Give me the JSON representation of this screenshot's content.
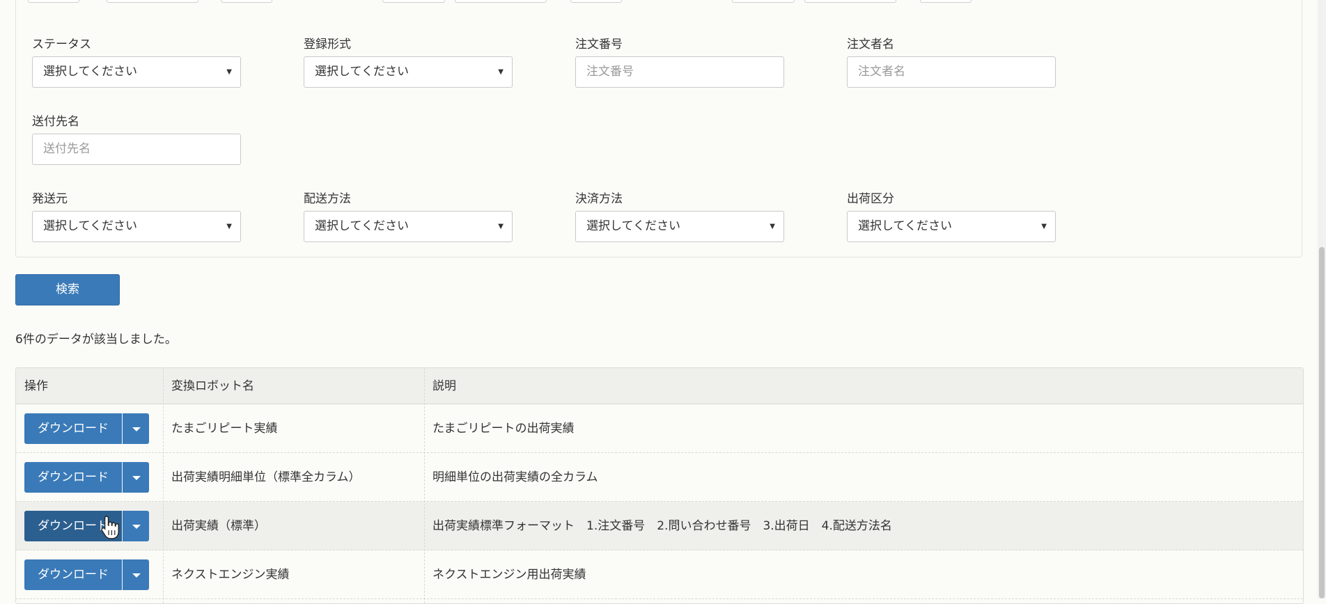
{
  "filters": {
    "status": {
      "label": "ステータス",
      "value": "選択してください"
    },
    "registration_type": {
      "label": "登録形式",
      "value": "選択してください"
    },
    "order_number": {
      "label": "注文番号",
      "placeholder": "注文番号"
    },
    "orderer_name": {
      "label": "注文者名",
      "placeholder": "注文者名"
    },
    "recipient_name": {
      "label": "送付先名",
      "placeholder": "送付先名"
    },
    "sender": {
      "label": "発送元",
      "value": "選択してください"
    },
    "delivery_method": {
      "label": "配送方法",
      "value": "選択してください"
    },
    "payment_method": {
      "label": "決済方法",
      "value": "選択してください"
    },
    "shipping_category": {
      "label": "出荷区分",
      "value": "選択してください"
    }
  },
  "search_button": "検索",
  "result_count_text": "6件のデータが該当しました。",
  "table": {
    "headers": [
      "操作",
      "変換ロボット名",
      "説明"
    ],
    "download_label": "ダウンロード",
    "rows": [
      {
        "name": "たまごリピート実績",
        "description": "たまごリピートの出荷実績"
      },
      {
        "name": "出荷実績明細単位（標準全カラム）",
        "description": "明細単位の出荷実績の全カラム"
      },
      {
        "name": "出荷実績（標準）",
        "description": "出荷実績標準フォーマット　1.注文番号　2.問い合わせ番号　3.出荷日　4.配送方法名"
      },
      {
        "name": "ネクストエンジン実績",
        "description": "ネクストエンジン用出荷実績"
      }
    ]
  },
  "icons": {
    "caret": "caret-down-icon",
    "cursor": "hand-pointer-icon"
  },
  "colors": {
    "primary": "#3a7ab8",
    "primary_hover": "#2b5f8f",
    "background": "#fbfbf8",
    "table_header": "#efefec"
  }
}
